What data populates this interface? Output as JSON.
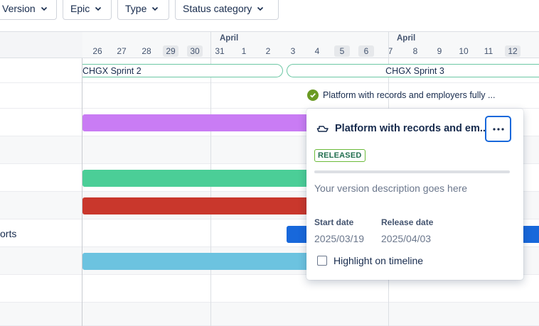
{
  "filters": [
    {
      "label": "Version"
    },
    {
      "label": "Epic"
    },
    {
      "label": "Type"
    },
    {
      "label": "Status category"
    }
  ],
  "timeline": {
    "months": [
      {
        "label": "April"
      },
      {
        "label": "April"
      }
    ],
    "days": [
      "26",
      "27",
      "28",
      "29",
      "30",
      "31",
      "1",
      "2",
      "3",
      "4",
      "5",
      "6",
      "7",
      "8",
      "9",
      "10",
      "11",
      "12"
    ],
    "weekend_days": [
      "29",
      "30",
      "5",
      "6",
      "12"
    ]
  },
  "rows": {
    "partial_label": "orts"
  },
  "sprints": [
    {
      "label": "CHGX Sprint 2"
    },
    {
      "label": "CHGX Sprint 3"
    }
  ],
  "release_marker": {
    "label": "Platform with records and employers fully ..."
  },
  "bars": {
    "colors": [
      "#c97cf4",
      "#4bce97",
      "#c9372c",
      "#1868db",
      "#6cc3e0"
    ]
  },
  "popup": {
    "title": "Platform with records and em...",
    "status": "RELEASED",
    "progress": 0,
    "description": "Your version description goes here",
    "start_date_label": "Start date",
    "start_date": "2025/03/19",
    "release_date_label": "Release date",
    "release_date": "2025/04/03",
    "highlight_label": "Highlight on timeline",
    "highlight_checked": false
  },
  "colors": {
    "accent": "#1868db",
    "released": "#6a9a23"
  },
  "icons": {
    "release": "ship-icon",
    "more": "more-icon",
    "chevron": "chevron-down-icon",
    "check": "check-circle-icon"
  }
}
